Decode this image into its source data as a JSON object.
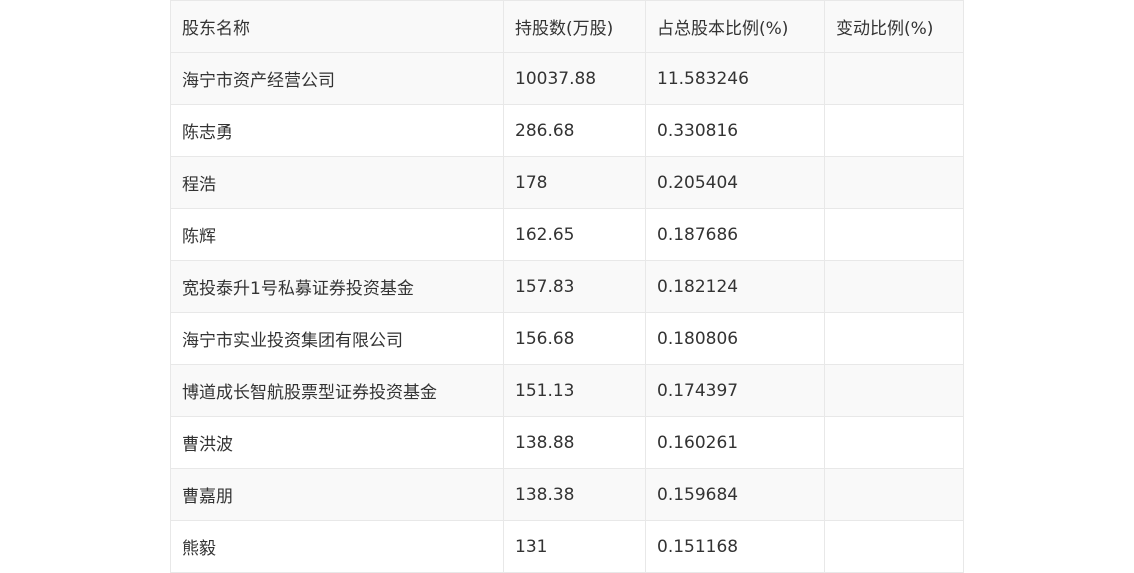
{
  "table": {
    "headers": [
      "股东名称",
      "持股数(万股)",
      "占总股本比例(%)",
      "变动比例(%)"
    ],
    "rows": [
      [
        "海宁市资产经营公司",
        "10037.88",
        "11.583246",
        ""
      ],
      [
        "陈志勇",
        "286.68",
        "0.330816",
        ""
      ],
      [
        "程浩",
        "178",
        "0.205404",
        ""
      ],
      [
        "陈辉",
        "162.65",
        "0.187686",
        ""
      ],
      [
        "宽投泰升1号私募证券投资基金",
        "157.83",
        "0.182124",
        ""
      ],
      [
        "海宁市实业投资集团有限公司",
        "156.68",
        "0.180806",
        ""
      ],
      [
        "博道成长智航股票型证券投资基金",
        "151.13",
        "0.174397",
        ""
      ],
      [
        "曹洪波",
        "138.88",
        "0.160261",
        ""
      ],
      [
        "曹嘉朋",
        "138.38",
        "0.159684",
        ""
      ],
      [
        "熊毅",
        "131",
        "0.151168",
        ""
      ]
    ]
  }
}
